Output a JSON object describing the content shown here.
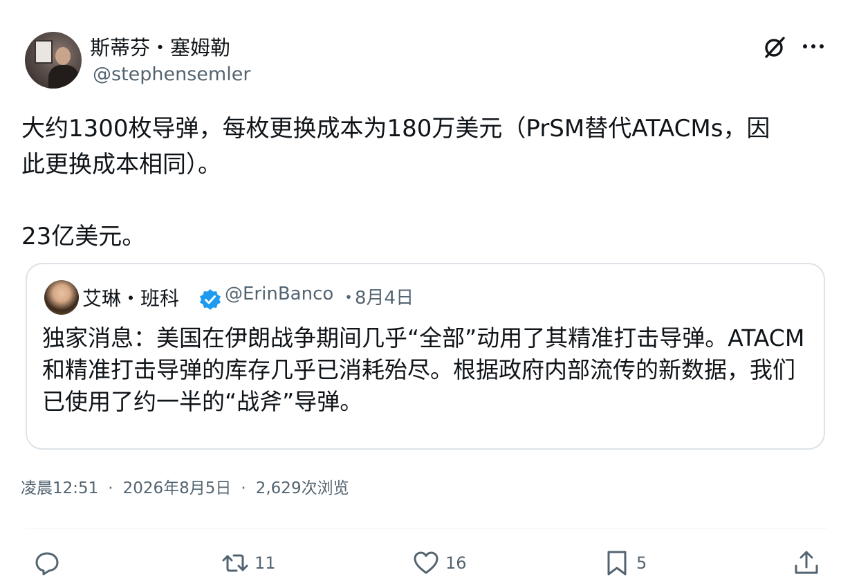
{
  "author": {
    "display_name": "斯蒂芬・塞姆勒",
    "handle": "@stephensemler"
  },
  "post": {
    "paragraph1": "大约1300枚导弹，每枚更换成本为180万美元（PrSM替代ATACMs，因此更换成本相同）。",
    "paragraph2": "23亿美元。"
  },
  "quoted": {
    "display_name": "艾琳・班科",
    "handle": "@ErinBanco",
    "separator": "・",
    "date": "8月4日",
    "text": "独家消息：美国在伊朗战争期间几乎“全部”动用了其精准打击导弹。ATACM和精准打击导弹的库存几乎已消耗殆尽。根据政府内部流传的新数据，我们已使用了约一半的“战斧”导弹。"
  },
  "meta": {
    "time": "凌晨12:51",
    "separator": "·",
    "date": "2026年8月5日",
    "views": "2,629次浏览"
  },
  "actions": {
    "retweets": "11",
    "likes": "16",
    "bookmarks": "5"
  },
  "icons": {
    "grok": "grok-icon",
    "more": "more-icon",
    "verified": "verified-badge-icon",
    "reply": "reply-icon",
    "retweet": "retweet-icon",
    "like": "heart-icon",
    "bookmark": "bookmark-icon",
    "share": "share-icon"
  },
  "colors": {
    "text_primary": "#0f1419",
    "text_secondary": "#536471",
    "verified_blue": "#1d9bf0",
    "border": "#dde3e8"
  }
}
